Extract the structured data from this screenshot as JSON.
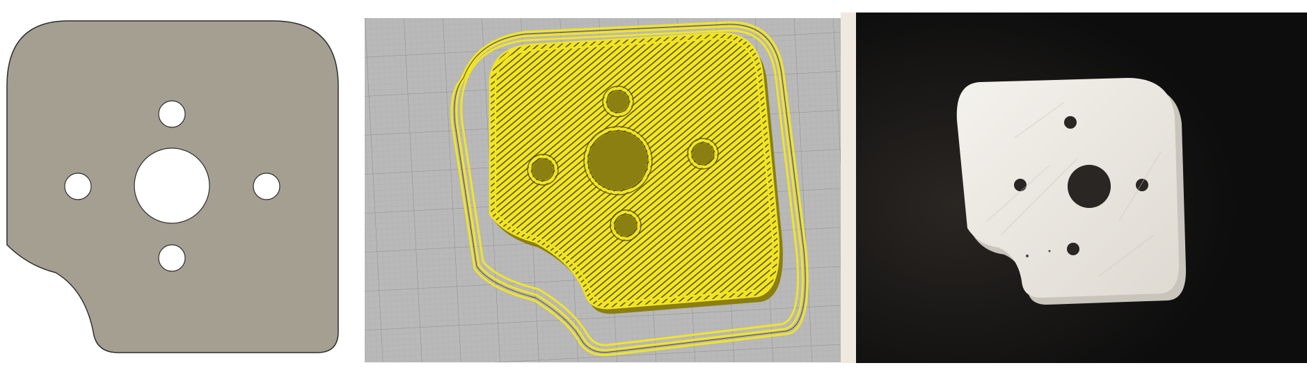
{
  "panels": [
    {
      "id": "cad-view",
      "name": "cad-plate-drawing"
    },
    {
      "id": "slicer-view",
      "name": "slicer-toolpath-preview"
    },
    {
      "id": "photo-view",
      "name": "printed-part-photo"
    }
  ],
  "colors": {
    "cad_plate": "#a59f92",
    "cad_outline": "#2d2d2d",
    "slicer_bed": "#b9b9b9",
    "slicer_grid": "#a3a3a3",
    "slicer_yellow": "#f2e526",
    "slicer_dark": "#5a5208",
    "photo_background": "#111111",
    "photo_part": "#eeebe4"
  }
}
